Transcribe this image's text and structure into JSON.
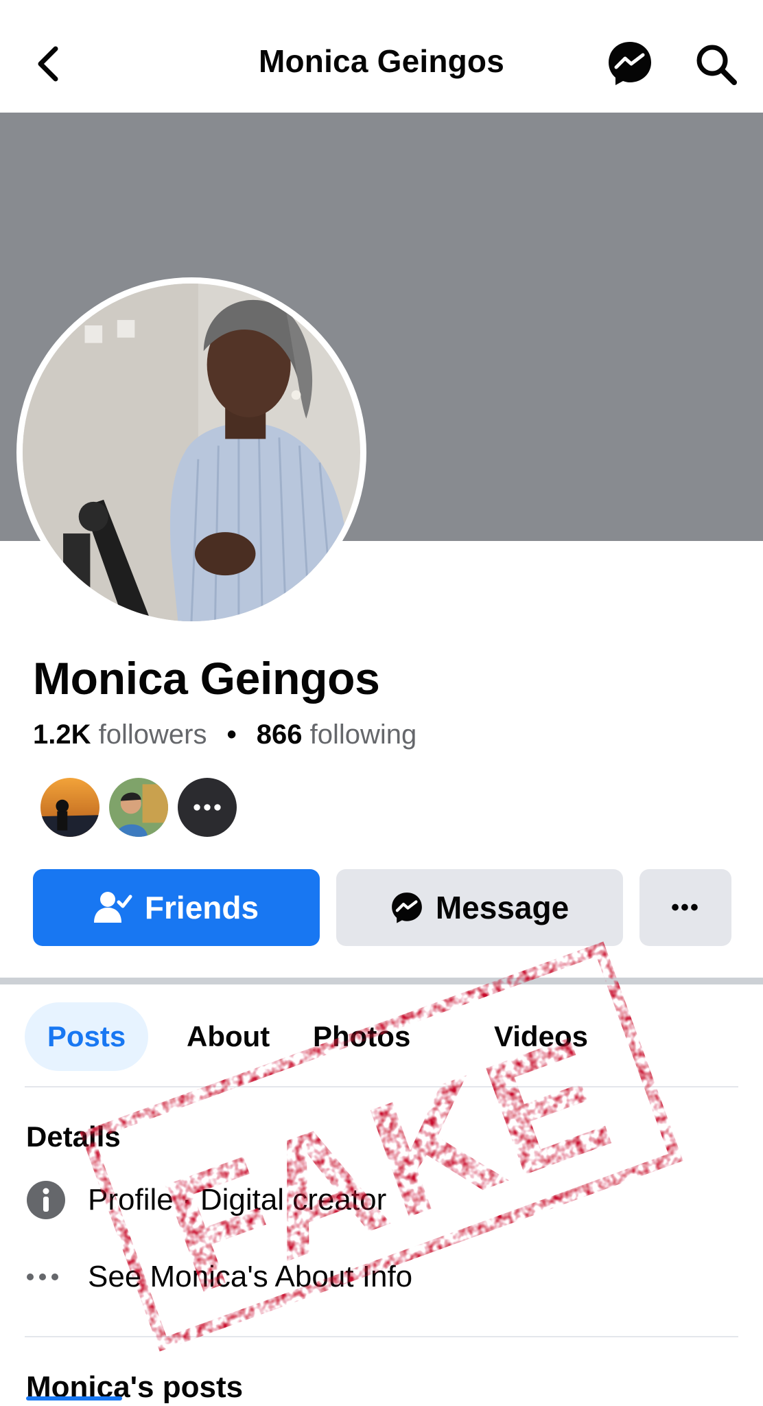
{
  "header": {
    "title": "Monica Geingos",
    "back_icon": "chevron-left-icon",
    "messenger_icon": "messenger-icon",
    "search_icon": "search-icon"
  },
  "profile": {
    "name": "Monica Geingos",
    "followers_count": "1.2K",
    "followers_label": "followers",
    "separator": "•",
    "following_count": "866",
    "following_label": "following"
  },
  "buttons": {
    "friends_label": "Friends",
    "message_label": "Message",
    "more_label": "•••"
  },
  "tabs": [
    {
      "label": "Posts",
      "active": true
    },
    {
      "label": "About",
      "active": false
    },
    {
      "label": "Photos",
      "active": false
    },
    {
      "label": "Videos",
      "active": false
    }
  ],
  "details": {
    "title": "Details",
    "profile_line": "Profile · Digital creator",
    "about_line": "See Monica's About Info"
  },
  "posts": {
    "title": "Monica's posts"
  },
  "stamp": {
    "text": "FAKE"
  },
  "colors": {
    "accent": "#1877f2",
    "stamp": "#c8102e",
    "cover": "#888b90"
  }
}
